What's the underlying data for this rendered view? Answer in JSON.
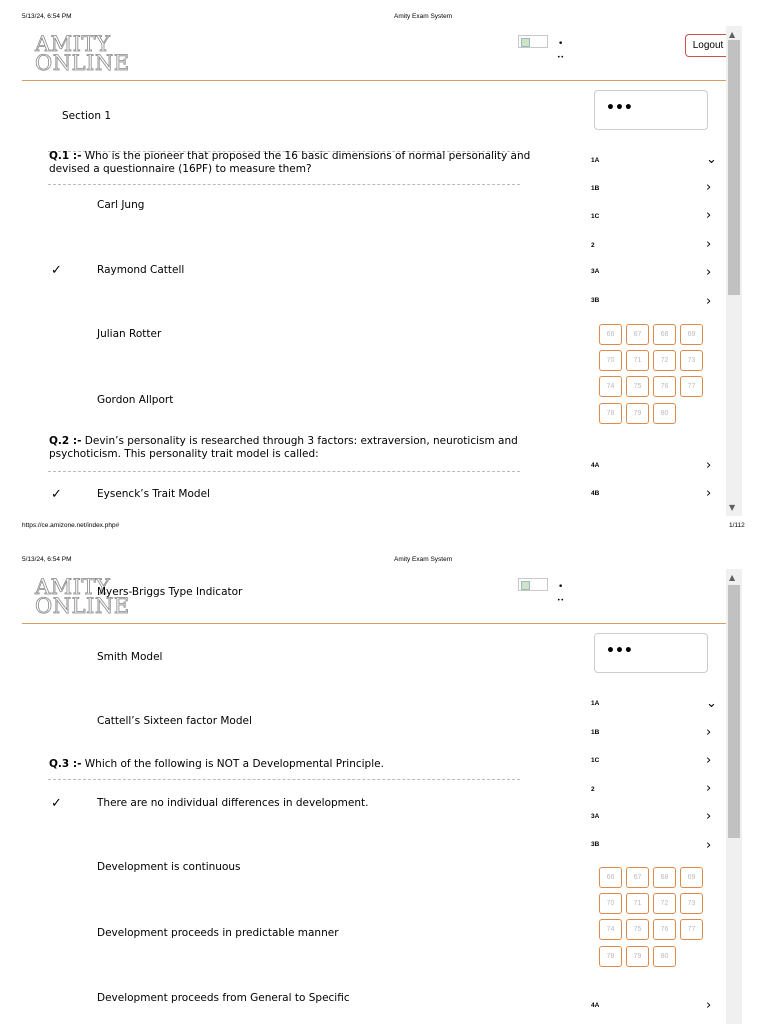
{
  "page1": {
    "print_header": {
      "datetime": "5/13/24, 6:54 PM",
      "title": "Amity Exam System"
    },
    "print_footer": {
      "url": "https://ce.amizone.net/index.php#",
      "page": "1/112"
    },
    "logo": {
      "line1": "AMITY",
      "line2": "ONLINE"
    },
    "header_dots": {
      "d1": "•",
      "d2": "••"
    },
    "logout_label": "Logout",
    "section_title": "Section 1",
    "ellipsis": "•••",
    "questions": [
      {
        "num": "Q.1 :-",
        "text": "Who is the pioneer that proposed the 16 basic dimensions of normal personality and devised a questionnaire (16PF) to measure them?"
      },
      {
        "num": "Q.2 :-",
        "text": "Devin’s personality is researched through 3 factors: extraversion, neuroticism and psychoticism. This personality trait model is called:"
      }
    ],
    "options": [
      "Carl Jung",
      "Raymond Cattell",
      "Julian Rotter",
      "Gordon Allport",
      "Eysenck’s Trait Model"
    ],
    "check": "✓",
    "nav": [
      "1A",
      "1B",
      "1C",
      "2",
      "3A",
      "3B",
      "4A",
      "4B"
    ],
    "chev_down": "⌄",
    "chev_right": "›",
    "qnums": [
      "66",
      "67",
      "68",
      "69",
      "70",
      "71",
      "72",
      "73",
      "74",
      "75",
      "76",
      "77",
      "78",
      "79",
      "80"
    ]
  },
  "page2": {
    "print_header": {
      "datetime": "5/13/24, 6:54 PM",
      "title": "Amity Exam System"
    },
    "logo": {
      "line1": "AMITY",
      "line2": "ONLINE"
    },
    "header_dots": {
      "d1": "•",
      "d2": "••"
    },
    "ellipsis": "•••",
    "options": [
      "Myers-Briggs Type Indicator",
      "Smith Model",
      "Cattell’s Sixteen factor Model",
      "There are no individual differences in development.",
      "Development is continuous",
      "Development proceeds in predictable manner",
      "Development proceeds from General to Specific"
    ],
    "question": {
      "num": "Q.3 :-",
      "text": "Which of the following is NOT a Developmental Principle."
    },
    "check": "✓",
    "nav": [
      "1A",
      "1B",
      "1C",
      "2",
      "3A",
      "3B",
      "4A"
    ],
    "qnums": [
      "66",
      "67",
      "68",
      "69",
      "70",
      "71",
      "72",
      "73",
      "74",
      "75",
      "76",
      "77",
      "78",
      "79",
      "80"
    ]
  },
  "scroll_arrows": {
    "up": "▲",
    "down": "▼"
  }
}
